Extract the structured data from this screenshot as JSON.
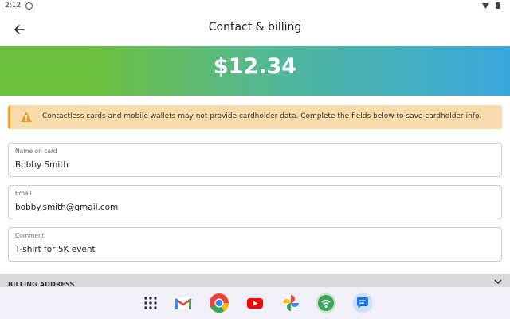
{
  "status_bar": {
    "time": "2:12"
  },
  "app_bar": {
    "title": "Contact & billing"
  },
  "amount": "$12.34",
  "warning": {
    "text": "Contactless cards and mobile wallets may not provide cardholder data. Complete the fields below to save cardholder info."
  },
  "fields": [
    {
      "label": "Name on card",
      "value": "Bobby Smith"
    },
    {
      "label": "Email",
      "value": "bobby.smith@gmail.com"
    },
    {
      "label": "Comment",
      "value": "T-shirt for 5K event"
    }
  ],
  "billing": {
    "label": "BILLING ADDRESS"
  },
  "taskbar": {
    "apps": [
      "app-drawer-icon",
      "gmail-icon",
      "chrome-icon",
      "youtube-icon",
      "photos-icon",
      "hotspot-app-icon",
      "messages-icon"
    ]
  },
  "colors": {
    "gradient_start": "#6cc03e",
    "gradient_end": "#3aa8e0",
    "warning_bg": "#f8dbaa",
    "warning_accent": "#f0a030"
  }
}
